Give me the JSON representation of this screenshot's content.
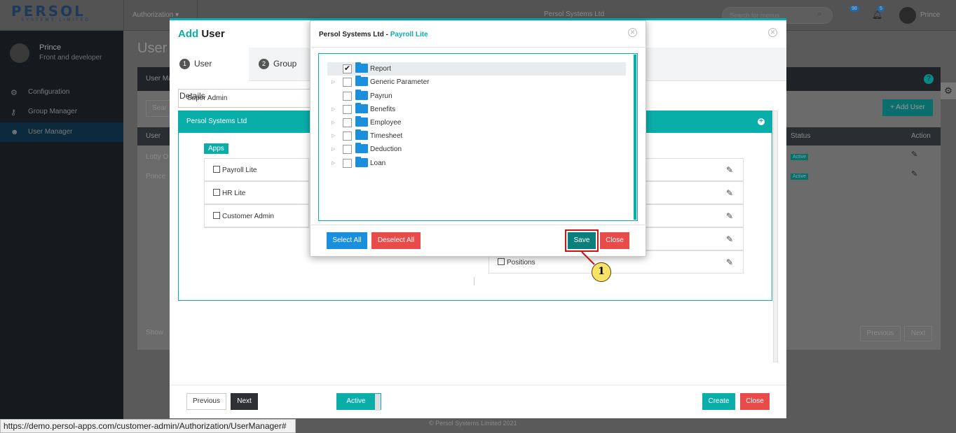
{
  "topbar": {
    "logo": "PERSOL",
    "logo_sub": "SYSTEMS LIMITED",
    "menu": "Authorization",
    "company": "Persol Systems Ltd",
    "search_placeholder": "Search for menus",
    "badge1": "98",
    "badge2": "5",
    "user": "Prince"
  },
  "sidebar": {
    "user_name": "Prince",
    "user_role": "Front and developer",
    "items": [
      {
        "label": "Configuration",
        "icon": "gear-icon"
      },
      {
        "label": "Group Manager",
        "icon": "key-icon"
      },
      {
        "label": "User Manager",
        "icon": "users-icon"
      }
    ]
  },
  "background": {
    "page_title": "User",
    "panel_label": "User Ma",
    "search_label": "Sear",
    "add_user": "+ Add User",
    "col_user": "User",
    "col_status": "Status",
    "col_action": "Action",
    "row1": "Lotty O",
    "row2": "Prince",
    "status": "Active",
    "show": "Show",
    "previous": "Previous",
    "next": "Next",
    "footer": "© Persol Systems Limited 2021"
  },
  "status_url": "https://demo.persol-apps.com/customer-admin/Authorization/UserManager#",
  "modal": {
    "title_prefix": "Add",
    "title_rest": "User",
    "tabs": [
      {
        "num": "1",
        "label": "User Details"
      },
      {
        "num": "2",
        "label": "Group"
      }
    ],
    "role_select": "Super Admin",
    "company_header": "Persol Systems Ltd",
    "apps_label": "Apps",
    "apps": [
      "Payroll Lite",
      "HR Lite",
      "Customer Admin"
    ],
    "perm_last": "Positions",
    "buttons": {
      "previous": "Previous",
      "next": "Next",
      "active": "Active",
      "create": "Create",
      "close": "Close"
    }
  },
  "dialog": {
    "title_company": "Persol Systems Ltd - ",
    "title_app": "Payroll Lite",
    "tree": [
      {
        "label": "Report",
        "checked": true,
        "expandable": false
      },
      {
        "label": "Generic Parameter",
        "checked": false,
        "expandable": true
      },
      {
        "label": "Payrun",
        "checked": false,
        "expandable": false
      },
      {
        "label": "Benefits",
        "checked": false,
        "expandable": true
      },
      {
        "label": "Employee",
        "checked": false,
        "expandable": true
      },
      {
        "label": "Timesheet",
        "checked": false,
        "expandable": true
      },
      {
        "label": "Deduction",
        "checked": false,
        "expandable": true
      },
      {
        "label": "Loan",
        "checked": false,
        "expandable": true
      }
    ],
    "buttons": {
      "select_all": "Select All",
      "deselect_all": "Deselect All",
      "save": "Save",
      "close": "Close"
    }
  },
  "callout": {
    "number": "1"
  }
}
